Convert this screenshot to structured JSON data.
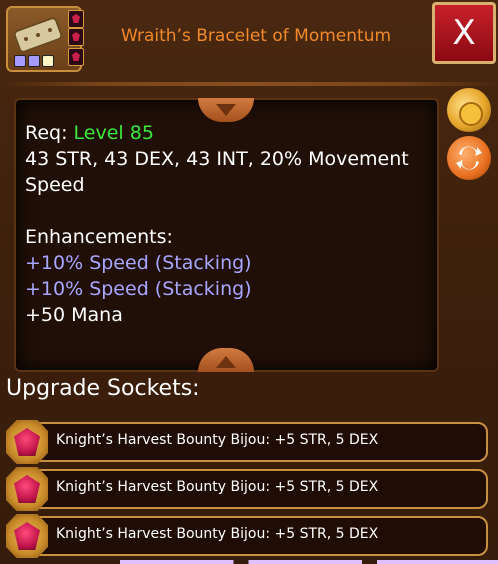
{
  "header": {
    "item_name": "Wraith’s Bracelet of Momentum",
    "close_label": "X",
    "rarity_colors": [
      "#a79bff",
      "#a79bff",
      "#fff6c8"
    ],
    "item_icon": "bracelet-icon",
    "mini_sockets": [
      "bijou-gem-icon",
      "bijou-gem-icon",
      "bijou-gem-icon"
    ]
  },
  "description": {
    "req_label": "Req:",
    "req_level": "Level 85",
    "stats_line1": "43 STR, 43 DEX, 43 INT, 20% Movement",
    "stats_line2": "Speed",
    "enh_title": "Enhancements:",
    "enhancements": [
      "+10% Speed (Stacking)",
      "+10% Speed (Stacking)",
      "+50 Mana"
    ]
  },
  "side_buttons": [
    "gold-bag-icon",
    "swap-icon"
  ],
  "sockets": {
    "title": "Upgrade Sockets:",
    "items": [
      "Knight’s Harvest Bounty Bijou: +5 STR, 5 DEX",
      "Knight’s Harvest Bounty Bijou: +5 STR, 5 DEX",
      "Knight’s Harvest Bounty Bijou: +5 STR, 5 DEX"
    ]
  },
  "colors": {
    "title": "#f08a2a",
    "level": "#3be83b",
    "enhancement": "#a8a6ff",
    "close_button": "#c8202a"
  }
}
